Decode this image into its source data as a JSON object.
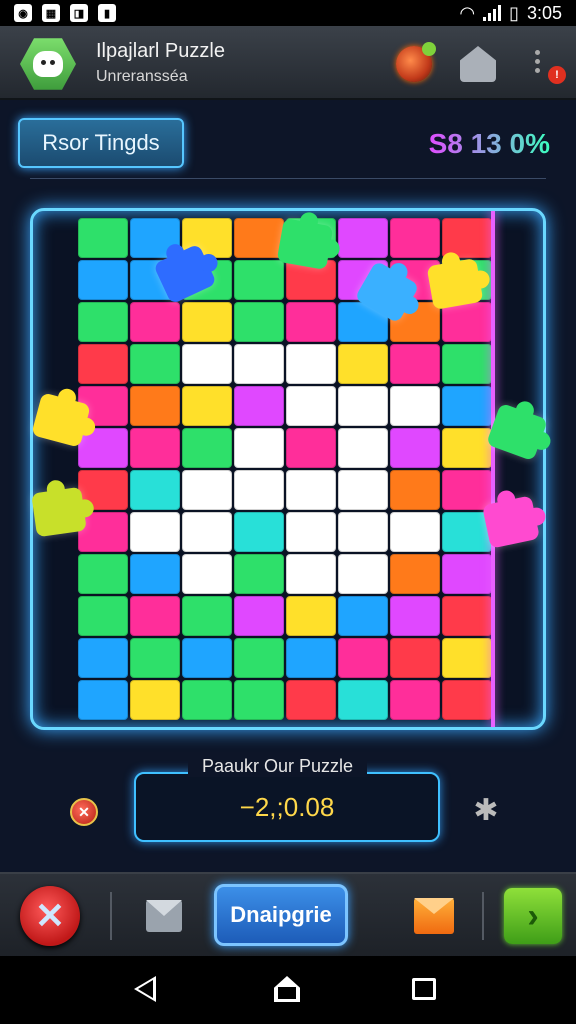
{
  "status_bar": {
    "time": "3:05",
    "left_icons": [
      "app-icon-1",
      "app-icon-2",
      "app-icon-3",
      "app-icon-4"
    ]
  },
  "app_bar": {
    "title": "Ilpajlarl Puzzle",
    "subtitle": "Unreransséa",
    "notification_count": "!",
    "icons": [
      "hexagon-logo-icon",
      "orb-icon",
      "home-icon",
      "overflow-menu-icon"
    ]
  },
  "mode_button": {
    "label": "Rsor Tingds"
  },
  "score": {
    "value": "S8 13 0%"
  },
  "board": {
    "columns": 8,
    "rows": 12,
    "palette": [
      "#2ee06a",
      "#1fa5ff",
      "#ff2e9a",
      "#ffe02a",
      "#ff7a1a",
      "#e048ff",
      "#28e0d8",
      "#ffffff",
      "#3c7cff",
      "#ff3a4a"
    ],
    "cells": [
      [
        0,
        1,
        3,
        4,
        0,
        5,
        2,
        9
      ],
      [
        1,
        1,
        0,
        0,
        9,
        5,
        2,
        0
      ],
      [
        0,
        2,
        3,
        0,
        2,
        1,
        4,
        2
      ],
      [
        9,
        0,
        7,
        7,
        7,
        3,
        2,
        0
      ],
      [
        2,
        4,
        3,
        5,
        7,
        7,
        7,
        1
      ],
      [
        5,
        2,
        0,
        7,
        2,
        7,
        5,
        3
      ],
      [
        9,
        6,
        7,
        7,
        7,
        7,
        4,
        2
      ],
      [
        2,
        7,
        7,
        6,
        7,
        7,
        7,
        6
      ],
      [
        0,
        1,
        7,
        0,
        7,
        7,
        4,
        5
      ],
      [
        0,
        2,
        0,
        5,
        3,
        1,
        5,
        9
      ],
      [
        1,
        0,
        1,
        0,
        1,
        2,
        9,
        3
      ],
      [
        1,
        3,
        0,
        0,
        9,
        6,
        2,
        9
      ]
    ],
    "loose_pieces": [
      {
        "color": "#2e6cff",
        "name": "loose-piece-blue-top"
      },
      {
        "color": "#2ee06a",
        "name": "loose-piece-green-top"
      },
      {
        "color": "#ffe02a",
        "name": "loose-piece-yellow-right"
      },
      {
        "color": "#ffe02a",
        "name": "loose-piece-yellow-left"
      },
      {
        "color": "#c8e02a",
        "name": "loose-piece-lime-left"
      },
      {
        "color": "#2ee06a",
        "name": "loose-piece-green-right"
      },
      {
        "color": "#ff4ad0",
        "name": "loose-piece-pink-right"
      },
      {
        "color": "#3ab0ff",
        "name": "loose-piece-blue-right"
      }
    ]
  },
  "puzzle_field": {
    "label": "Paaukr Our Puzzle",
    "value": "−2,;0.08"
  },
  "bottom_bar": {
    "action_label": "Dnaipgrie"
  },
  "colors": {
    "accent_cyan": "#3fc0ff",
    "accent_magenta": "#e860ff",
    "background": "#0d1528"
  }
}
